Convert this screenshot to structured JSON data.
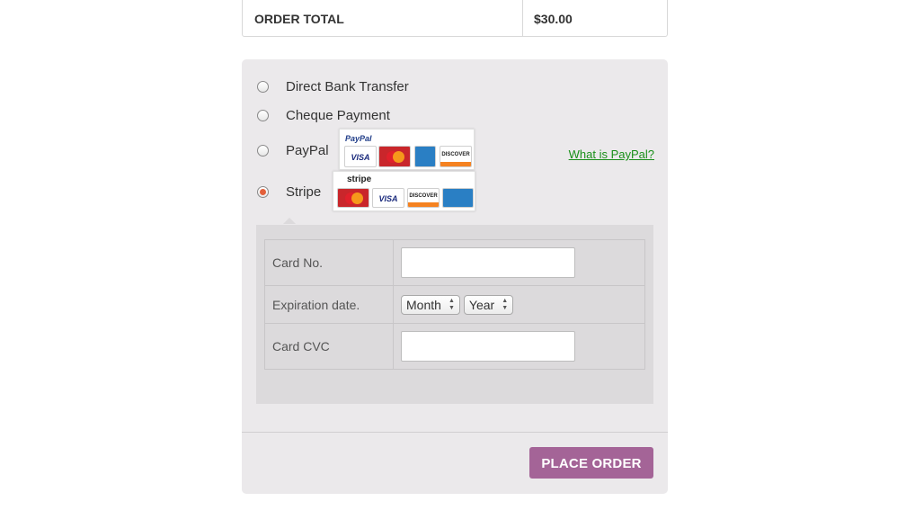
{
  "order_total": {
    "label": "ORDER TOTAL",
    "value": "$30.00"
  },
  "payment_methods": [
    {
      "label": "Direct Bank Transfer",
      "selected": false
    },
    {
      "label": "Cheque Payment",
      "selected": false
    },
    {
      "label": "PayPal",
      "selected": false,
      "logo_brand": "PayPal",
      "cards": [
        "VISA",
        "MasterCard",
        "AMERICAN EXPRESS",
        "DISCOVER"
      ]
    },
    {
      "label": "Stripe",
      "selected": true,
      "logo_brand": "stripe",
      "cards": [
        "MasterCard",
        "VISA",
        "DISCOVER",
        "AMERICAN EXPRESS"
      ]
    }
  ],
  "paypal_link": "What is PayPal?",
  "stripe_form": {
    "card_no_label": "Card No.",
    "card_no_value": "",
    "expiration_label": "Expiration date.",
    "month_value": "Month",
    "year_value": "Year",
    "cvc_label": "Card CVC",
    "cvc_value": ""
  },
  "place_order_label": "PLACE ORDER",
  "colors": {
    "accent": "#a46497",
    "link": "#1a8f1a",
    "radio_selected": "#e3603b",
    "panel_bg": "#ebe9eb"
  }
}
